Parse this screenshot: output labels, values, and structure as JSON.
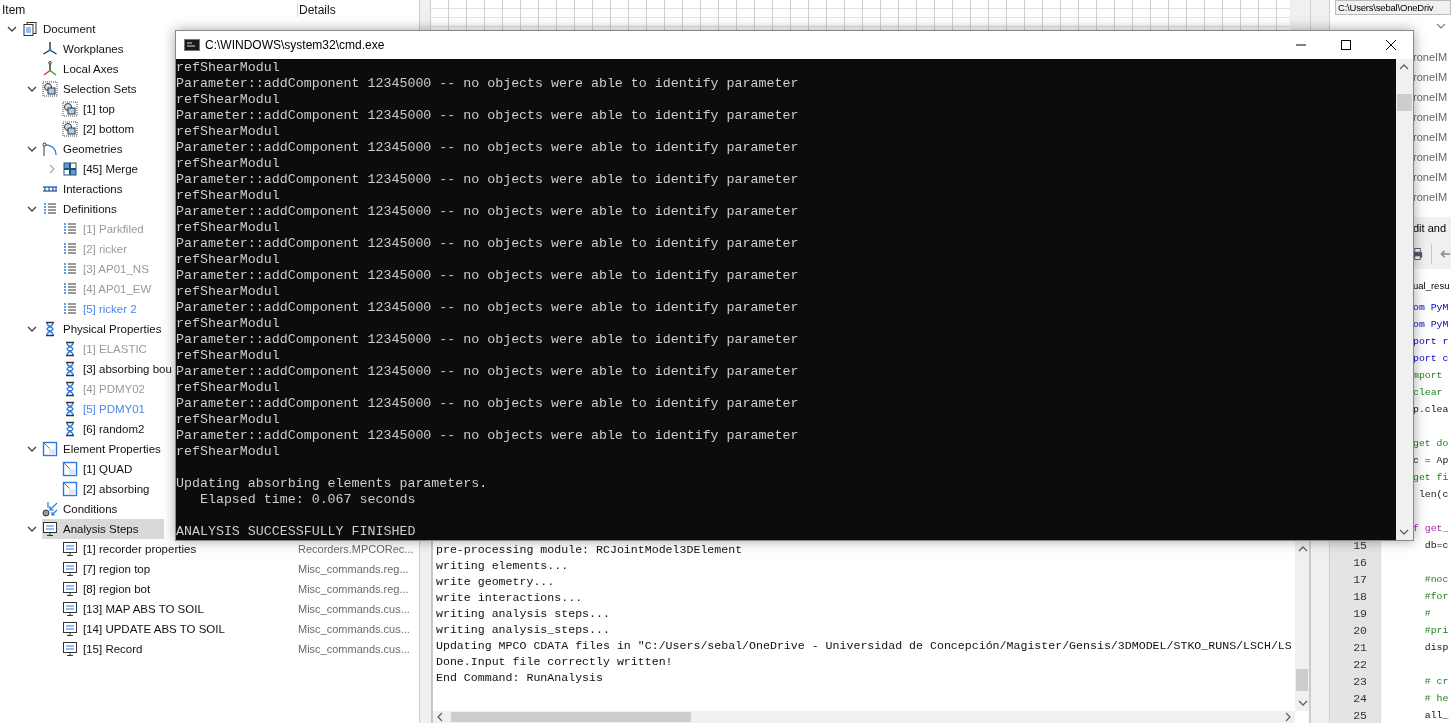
{
  "tree": {
    "columns": [
      "Item",
      "Details"
    ],
    "items": [
      {
        "label": "Document",
        "kind": "document",
        "expanded": true,
        "selected": false,
        "children": [
          {
            "label": "Workplanes",
            "kind": "workplanes",
            "selected": false
          },
          {
            "label": "Local Axes",
            "kind": "axes",
            "selected": false
          },
          {
            "label": "Selection Sets",
            "kind": "selection",
            "expanded": true,
            "selected": false,
            "children": [
              {
                "label": "[1] top",
                "kind": "selection",
                "selected": false
              },
              {
                "label": "[2] bottom",
                "kind": "selection",
                "selected": false
              }
            ]
          },
          {
            "label": "Geometries",
            "kind": "geometry",
            "expanded": true,
            "selected": false,
            "children": [
              {
                "label": "[45] Merge",
                "kind": "merge",
                "expanded": false,
                "selected": false
              }
            ]
          },
          {
            "label": "Interactions",
            "kind": "interactions",
            "selected": false
          },
          {
            "label": "Definitions",
            "kind": "list",
            "expanded": true,
            "selected": false,
            "children": [
              {
                "label": "[1] Parkfiled",
                "kind": "list",
                "disabled": true,
                "highlighted": false,
                "selected": false
              },
              {
                "label": "[2] ricker",
                "kind": "list",
                "disabled": true,
                "highlighted": false,
                "selected": false
              },
              {
                "label": "[3] AP01_NS",
                "kind": "list",
                "disabled": true,
                "highlighted": false,
                "selected": false
              },
              {
                "label": "[4] AP01_EW",
                "kind": "list",
                "disabled": true,
                "highlighted": false,
                "selected": false
              },
              {
                "label": "[5] ricker 2",
                "kind": "list",
                "disabled": false,
                "highlighted": true,
                "selected": false
              }
            ]
          },
          {
            "label": "Physical Properties",
            "kind": "hourglass",
            "expanded": true,
            "selected": false,
            "children": [
              {
                "label": "[1] ELASTIC",
                "kind": "hourglass",
                "disabled": true,
                "highlighted": false,
                "selected": false
              },
              {
                "label": "[3] absorbing bou",
                "kind": "hourglass",
                "disabled": false,
                "highlighted": false,
                "selected": false
              },
              {
                "label": "[4] PDMY02",
                "kind": "hourglass",
                "disabled": true,
                "highlighted": false,
                "selected": false
              },
              {
                "label": "[5] PDMY01",
                "kind": "hourglass",
                "disabled": false,
                "highlighted": true,
                "selected": false
              },
              {
                "label": "[6] random2",
                "kind": "hourglass",
                "disabled": false,
                "highlighted": false,
                "selected": false
              }
            ]
          },
          {
            "label": "Element Properties",
            "kind": "element",
            "expanded": true,
            "selected": false,
            "children": [
              {
                "label": "[1] QUAD",
                "kind": "element",
                "selected": false
              },
              {
                "label": "[2] absorbing",
                "kind": "element",
                "selected": false
              }
            ]
          },
          {
            "label": "Conditions",
            "kind": "conditions",
            "selected": false
          },
          {
            "label": "Analysis Steps",
            "kind": "monitor",
            "expanded": true,
            "selected": true,
            "children": [
              {
                "label": "[1] recorder properties",
                "kind": "monitor",
                "details": "Recorders.MPCORec...",
                "selected": false
              },
              {
                "label": "[7] region top",
                "kind": "monitor",
                "details": "Misc_commands.reg...",
                "selected": false
              },
              {
                "label": "[8] region bot",
                "kind": "monitor",
                "details": "Misc_commands.reg...",
                "selected": false
              },
              {
                "label": "[13] MAP ABS TO SOIL",
                "kind": "monitor",
                "details": "Misc_commands.cus...",
                "selected": false
              },
              {
                "label": "[14] UPDATE ABS TO SOIL",
                "kind": "monitor",
                "details": "Misc_commands.cus...",
                "selected": false
              },
              {
                "label": "[15] Record",
                "kind": "monitor",
                "details": "Misc_commands.cus...",
                "selected": false
              }
            ]
          }
        ]
      }
    ]
  },
  "output_console": {
    "lines": [
      "pre-processing module: RCJointModel3DElement",
      "writing elements...",
      "write geometry...",
      "write interactions...",
      "writing analysis steps...",
      "writing analysis_steps...",
      "Updating MPCO CDATA files in \"C:/Users/sebal/OneDrive - Universidad de Concepción/Magister/Gensis/3DMODEL/STKO_RUNS/LSCH/LS",
      "Done.Input file correctly written!",
      "End Command: RunAnalysis"
    ]
  },
  "right_panel": {
    "path_field": "C:\\Users\\sebal\\OneDriv",
    "file_list": [
      {
        "label": "roneIM"
      },
      {
        "label": "roneIM"
      },
      {
        "label": "roneIM"
      },
      {
        "label": "roneIM"
      },
      {
        "label": "roneIM"
      },
      {
        "label": "roneIM"
      },
      {
        "label": "roneIM"
      },
      {
        "label": "roneIM"
      }
    ],
    "panel_title": "dit and",
    "editor_tab": "ual_resu",
    "editor_lines": [
      {
        "text": "om PyM",
        "kind": "keyword"
      },
      {
        "text": "om PyM",
        "kind": "keyword"
      },
      {
        "text": "port r",
        "kind": "keyword"
      },
      {
        "text": "port c",
        "kind": "keyword"
      },
      {
        "text": "mport",
        "kind": "comment"
      },
      {
        "text": "clear",
        "kind": "comment"
      },
      {
        "text": "p.clea",
        "kind": "code"
      },
      {
        "kind": "blank"
      },
      {
        "text": "get do",
        "kind": "comment"
      },
      {
        "text": "c = Ap",
        "kind": "code"
      },
      {
        "text": "get fi",
        "kind": "comment"
      },
      {
        "text": " len(c",
        "kind": "code"
      },
      {
        "kind": "blank"
      },
      {
        "text": "f get_",
        "kind": "definition"
      },
      {
        "number": "15",
        "text": "  db=c",
        "kind": "code"
      },
      {
        "number": "16",
        "kind": "blank"
      },
      {
        "number": "17",
        "text": "  #noc",
        "kind": "comment"
      },
      {
        "number": "18",
        "text": "  #for",
        "kind": "comment"
      },
      {
        "number": "19",
        "text": "  #",
        "kind": "comment"
      },
      {
        "number": "20",
        "text": "  #pri",
        "kind": "comment"
      },
      {
        "number": "21",
        "text": "  disp",
        "kind": "code"
      },
      {
        "number": "22",
        "kind": "blank"
      },
      {
        "number": "23",
        "text": "  # cr",
        "kind": "comment"
      },
      {
        "number": "24",
        "text": "  # he",
        "kind": "comment"
      },
      {
        "number": "25",
        "text": "  all_",
        "kind": "code"
      }
    ]
  },
  "cmd_window": {
    "title": "C:\\WINDOWS\\system32\\cmd.exe",
    "lines": [
      {
        "kind": "text",
        "text": "refShearModul"
      },
      {
        "kind": "text",
        "text": "Parameter::addComponent 12345000 -- no objects were able to identify parameter"
      },
      {
        "kind": "text",
        "text": "refShearModul"
      },
      {
        "kind": "text",
        "text": "Parameter::addComponent 12345000 -- no objects were able to identify parameter"
      },
      {
        "kind": "text",
        "text": "refShearModul"
      },
      {
        "kind": "text",
        "text": "Parameter::addComponent 12345000 -- no objects were able to identify parameter"
      },
      {
        "kind": "text",
        "text": "refShearModul"
      },
      {
        "kind": "text",
        "text": "Parameter::addComponent 12345000 -- no objects were able to identify parameter"
      },
      {
        "kind": "text",
        "text": "refShearModul"
      },
      {
        "kind": "text",
        "text": "Parameter::addComponent 12345000 -- no objects were able to identify parameter"
      },
      {
        "kind": "text",
        "text": "refShearModul"
      },
      {
        "kind": "text",
        "text": "Parameter::addComponent 12345000 -- no objects were able to identify parameter"
      },
      {
        "kind": "text",
        "text": "refShearModul"
      },
      {
        "kind": "text",
        "text": "Parameter::addComponent 12345000 -- no objects were able to identify parameter"
      },
      {
        "kind": "text",
        "text": "refShearModul"
      },
      {
        "kind": "text",
        "text": "Parameter::addComponent 12345000 -- no objects were able to identify parameter"
      },
      {
        "kind": "text",
        "text": "refShearModul"
      },
      {
        "kind": "text",
        "text": "Parameter::addComponent 12345000 -- no objects were able to identify parameter"
      },
      {
        "kind": "text",
        "text": "refShearModul"
      },
      {
        "kind": "text",
        "text": "Parameter::addComponent 12345000 -- no objects were able to identify parameter"
      },
      {
        "kind": "text",
        "text": "refShearModul"
      },
      {
        "kind": "text",
        "text": "Parameter::addComponent 12345000 -- no objects were able to identify parameter"
      },
      {
        "kind": "text",
        "text": "refShearModul"
      },
      {
        "kind": "text",
        "text": "Parameter::addComponent 12345000 -- no objects were able to identify parameter"
      },
      {
        "kind": "text",
        "text": "refShearModul"
      },
      {
        "kind": "blank"
      },
      {
        "kind": "text",
        "text": "Updating absorbing elements parameters."
      },
      {
        "kind": "text",
        "text": "   Elapsed time: 0.067 seconds"
      },
      {
        "kind": "blank"
      },
      {
        "kind": "text",
        "text": "ANALYSIS SUCCESSFULLY FINISHED"
      }
    ]
  }
}
